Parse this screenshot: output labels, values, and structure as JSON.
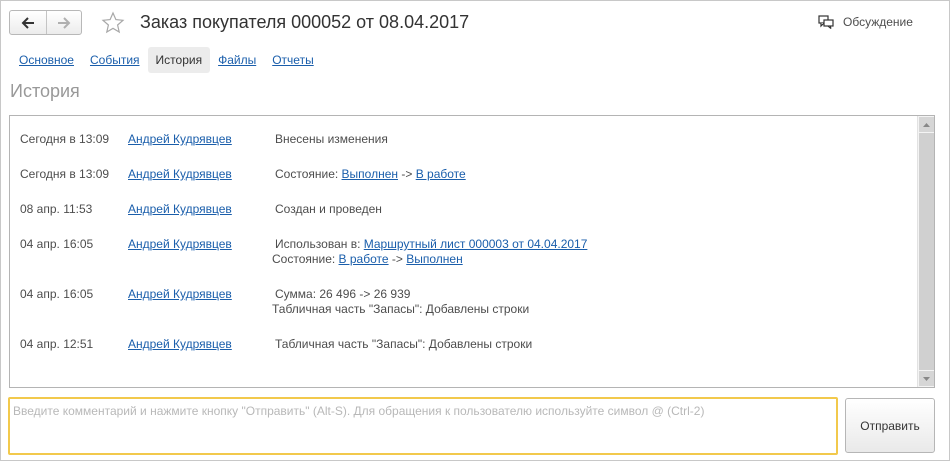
{
  "header": {
    "back_icon": "arrow-left-icon",
    "forward_icon": "arrow-right-icon",
    "favorite_icon": "star-outline-icon",
    "title": "Заказ покупателя 000052 от 08.04.2017",
    "discussion_label": "Обсуждение",
    "discussion_icon": "chat-bubbles-icon"
  },
  "tabs": [
    {
      "label": "Основное",
      "active": false
    },
    {
      "label": "События",
      "active": false
    },
    {
      "label": "История",
      "active": true
    },
    {
      "label": "Файлы",
      "active": false
    },
    {
      "label": "Отчеты",
      "active": false
    }
  ],
  "section_title": "История",
  "history": [
    {
      "time": "Сегодня в 13:09",
      "user": "Андрей Кудрявцев",
      "line1": {
        "text": "Внесены изменения"
      }
    },
    {
      "time": "Сегодня в 13:09",
      "user": "Андрей Кудрявцев",
      "line1": {
        "prefix": "Состояние: ",
        "link1": "Выполнен",
        "sep": " -> ",
        "link2": "В работе"
      }
    },
    {
      "time": "08 апр. 11:53",
      "user": "Андрей Кудрявцев",
      "line1": {
        "text": "Создан и проведен"
      }
    },
    {
      "time": "04 апр. 16:05",
      "user": "Андрей Кудрявцев",
      "line1": {
        "prefix": "Использован в: ",
        "link1": "Маршрутный лист 000003 от 04.04.2017"
      },
      "line2": {
        "prefix": "Состояние: ",
        "link1": "В работе",
        "sep": " -> ",
        "link2": "Выполнен"
      }
    },
    {
      "time": "04 апр. 16:05",
      "user": "Андрей Кудрявцев",
      "line1": {
        "text": "Сумма: 26 496 -> 26 939"
      },
      "line2": {
        "text": "Табличная часть \"Запасы\": Добавлены строки"
      }
    },
    {
      "time": "04 апр. 12:51",
      "user": "Андрей Кудрявцев",
      "line1": {
        "text": "Табличная часть \"Запасы\": Добавлены строки"
      }
    }
  ],
  "comment": {
    "placeholder": "Введите комментарий и нажмите кнопку \"Отправить\" (Alt-S). Для обращения к пользователю используйте символ @ (Ctrl-2)",
    "value": ""
  },
  "send_button_label": "Отправить",
  "colors": {
    "link": "#1a5eab",
    "focus_border": "#f2c94c",
    "muted_title": "#999999"
  }
}
